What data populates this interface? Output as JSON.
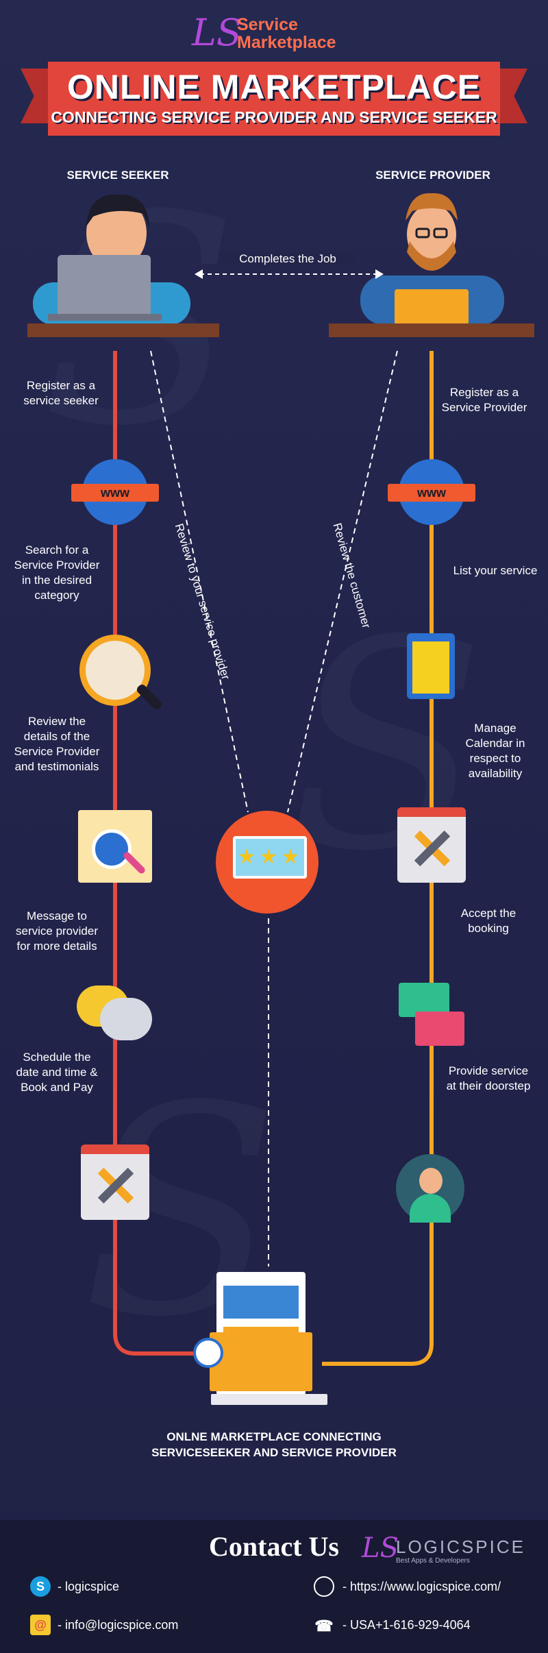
{
  "brand": {
    "logo_mark": "LS",
    "line1": "Service",
    "line2": "Marketplace"
  },
  "banner": {
    "title": "ONLINE MARKETPLACE",
    "subtitle": "CONNECTING SERVICE PROVIDER AND SERVICE SEEKER"
  },
  "columns": {
    "seeker": "SERVICE SEEKER",
    "provider": "SERVICE PROVIDER"
  },
  "center_link": "Completes the Job",
  "seeker_steps": [
    "Register as a service seeker",
    "Search for a Service Provider in the desired category",
    "Review the details of the Service Provider and testimonials",
    "Message to service provider for more details",
    "Schedule the date and time & Book and Pay"
  ],
  "provider_steps": [
    "Register as a Service Provider",
    "List your service",
    "Manage Calendar in respect to availability",
    "Accept the booking",
    "Provide service at their doorstep"
  ],
  "review_labels": {
    "left": "Review to your service provider",
    "right": "Review the customer"
  },
  "www_label": "www",
  "bottom_title": "ONLNE MARKETPLACE CONNECTING SERVICESEEKER AND SERVICE PROVIDER",
  "contact": {
    "title": "Contact Us",
    "logo_mark": "LS",
    "logo_text": "LOGICSPICE",
    "logo_tagline": "Best Apps & Developers",
    "skype": "- logicspice",
    "email": "- info@logicspice.com",
    "website": "- https://www.logicspice.com/",
    "phone": "- USA+1-616-929-4064"
  },
  "colors": {
    "background": "#23254a",
    "seeker_line": "#e34b3f",
    "provider_line": "#f5a623",
    "accent": "#f0552e",
    "ribbon": "#e2453b"
  }
}
